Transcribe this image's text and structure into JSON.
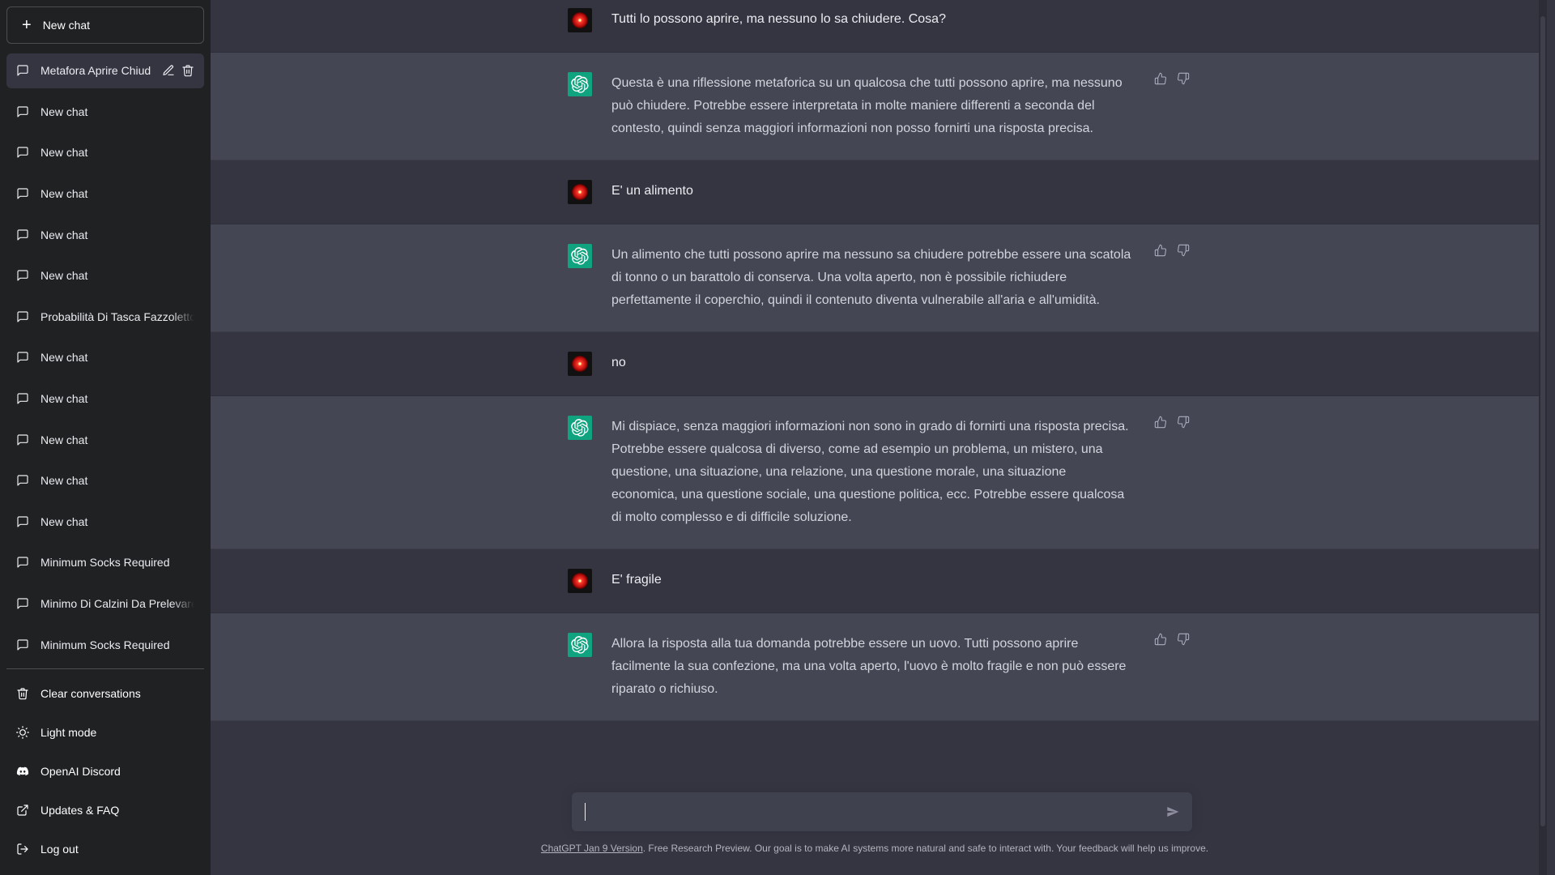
{
  "sidebar": {
    "new_chat_label": "New chat",
    "chats": [
      {
        "label": "Metafora Aprire Chiude",
        "active": true
      },
      {
        "label": "New chat"
      },
      {
        "label": "New chat"
      },
      {
        "label": "New chat"
      },
      {
        "label": "New chat"
      },
      {
        "label": "New chat"
      },
      {
        "label": "Probabilità Di Tasca Fazzoletto"
      },
      {
        "label": "New chat"
      },
      {
        "label": "New chat"
      },
      {
        "label": "New chat"
      },
      {
        "label": "New chat"
      },
      {
        "label": "New chat"
      },
      {
        "label": "Minimum Socks Required"
      },
      {
        "label": "Minimo Di Calzini Da Prelevare"
      },
      {
        "label": "Minimum Socks Required"
      }
    ],
    "footer": {
      "clear": "Clear conversations",
      "light_mode": "Light mode",
      "discord": "OpenAI Discord",
      "updates": "Updates & FAQ",
      "logout": "Log out"
    }
  },
  "conversation": [
    {
      "role": "user",
      "text": "Tutti lo possono aprire, ma nessuno lo sa chiudere. Cosa?"
    },
    {
      "role": "assistant",
      "text": "Questa è una riflessione metaforica su un qualcosa che tutti possono aprire, ma nessuno può chiudere. Potrebbe essere interpretata in molte maniere differenti a seconda del contesto, quindi senza maggiori informazioni non posso fornirti una risposta precisa."
    },
    {
      "role": "user",
      "text": "E' un alimento"
    },
    {
      "role": "assistant",
      "text": "Un alimento che tutti possono aprire ma nessuno sa chiudere potrebbe essere una scatola di tonno o un barattolo di conserva. Una volta aperto, non è possibile richiudere perfettamente il coperchio, quindi il contenuto diventa vulnerabile all'aria e all'umidità."
    },
    {
      "role": "user",
      "text": "no"
    },
    {
      "role": "assistant",
      "text": "Mi dispiace, senza maggiori informazioni non sono in grado di fornirti una risposta precisa. Potrebbe essere qualcosa di diverso, come ad esempio un problema, un mistero, una questione, una situazione, una relazione, una questione morale, una situazione economica, una questione sociale, una questione politica, ecc. Potrebbe essere qualcosa di molto complesso e di difficile soluzione."
    },
    {
      "role": "user",
      "text": "E' fragile"
    },
    {
      "role": "assistant",
      "text": "Allora la risposta alla tua domanda potrebbe essere un uovo. Tutti possono aprire facilmente la sua confezione, ma una volta aperto, l'uovo è molto fragile e non può essere riparato o richiuso."
    }
  ],
  "input": {
    "value": "",
    "placeholder": ""
  },
  "disclaimer": {
    "link_text": "ChatGPT Jan 9 Version",
    "text": ". Free Research Preview. Our goal is to make AI systems more natural and safe to interact with. Your feedback will help us improve."
  },
  "colors": {
    "sidebar_bg": "#202123",
    "user_bg": "#343541",
    "assistant_bg": "#444654",
    "gpt_avatar": "#10a37f"
  }
}
